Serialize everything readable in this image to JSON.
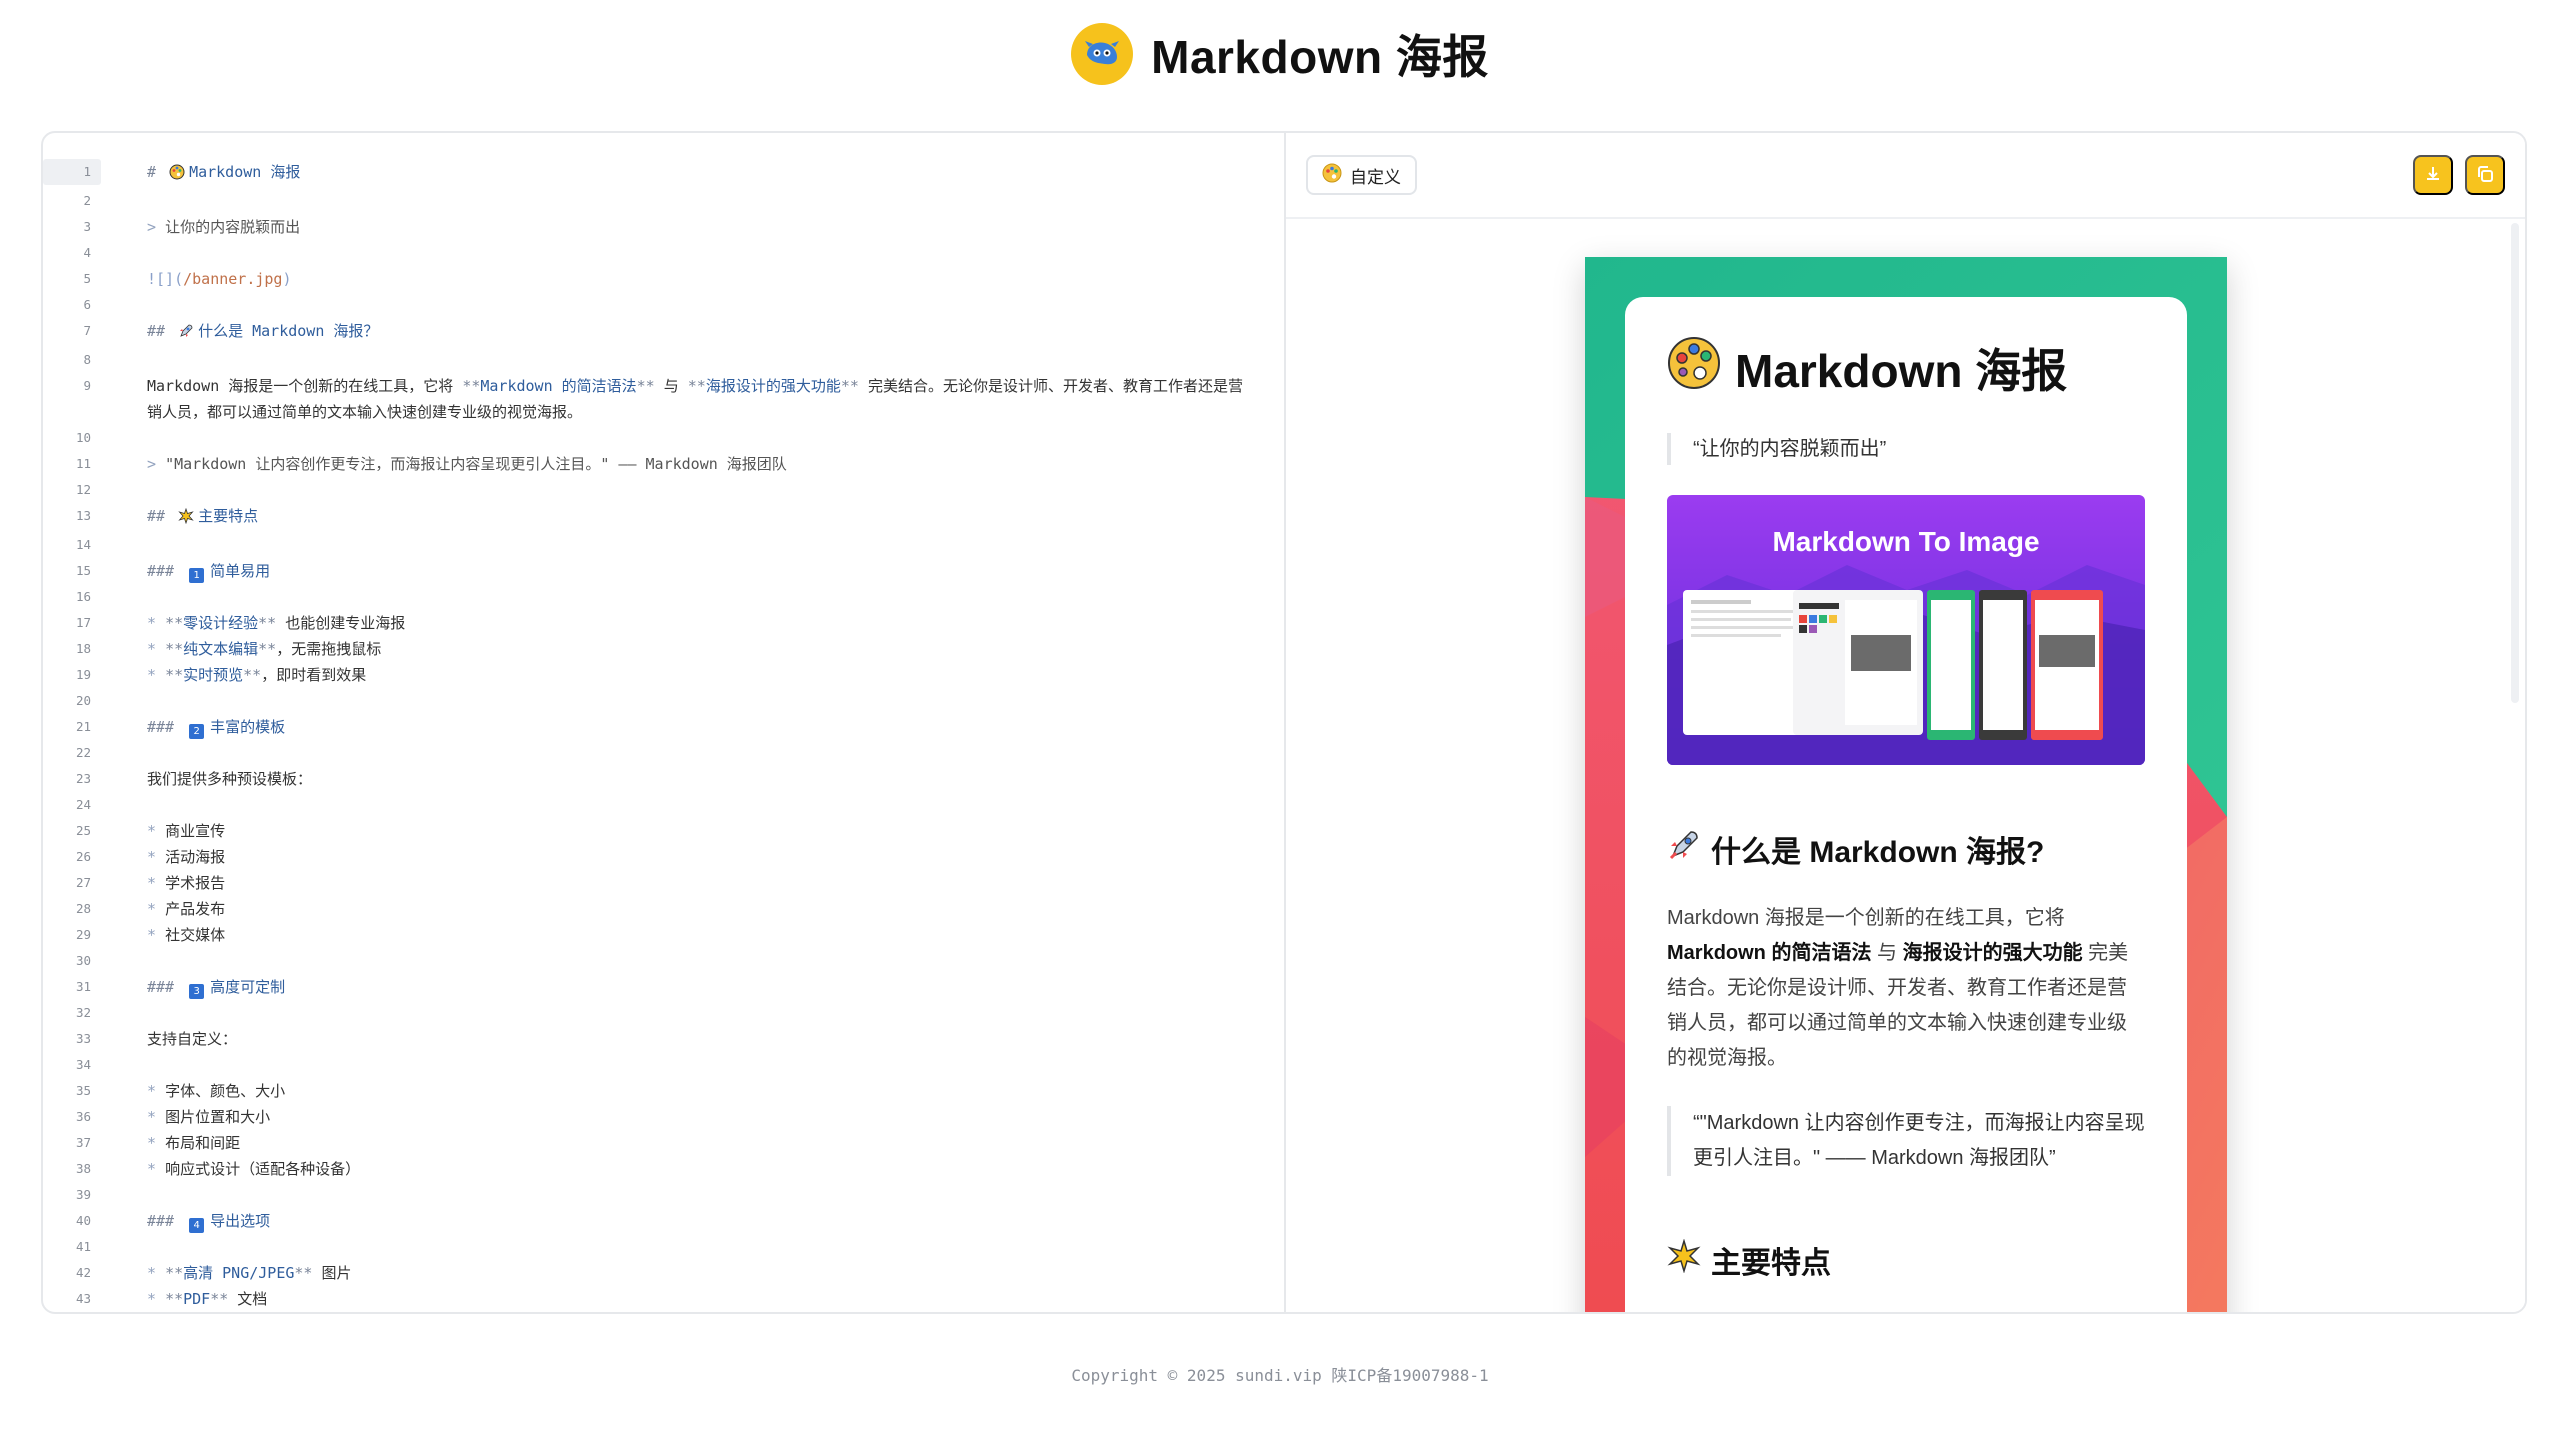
{
  "header": {
    "title": "Markdown 海报"
  },
  "editor": {
    "lines": [
      {
        "n": "1",
        "fold": true,
        "active": true,
        "parts": [
          {
            "c": "mk",
            "t": "# "
          },
          {
            "e": "palette"
          },
          {
            "c": "hd",
            "t": "Markdown 海报"
          }
        ]
      },
      {
        "n": "2",
        "parts": []
      },
      {
        "n": "3",
        "parts": [
          {
            "c": "bullet",
            "t": "> "
          },
          {
            "c": "quote",
            "t": "让你的内容脱颖而出"
          }
        ]
      },
      {
        "n": "4",
        "parts": []
      },
      {
        "n": "5",
        "parts": [
          {
            "c": "img-br",
            "t": "![]("
          },
          {
            "c": "img-link",
            "t": "/banner.jpg"
          },
          {
            "c": "img-br",
            "t": ")"
          }
        ]
      },
      {
        "n": "6",
        "parts": []
      },
      {
        "n": "7",
        "fold": true,
        "parts": [
          {
            "c": "mk",
            "t": "## "
          },
          {
            "e": "rocket"
          },
          {
            "c": "hd",
            "t": "什么是 Markdown 海报？"
          }
        ]
      },
      {
        "n": "8",
        "parts": []
      },
      {
        "n": "9",
        "parts": [
          {
            "t": "Markdown 海报是一个创新的在线工具，它将 "
          },
          {
            "c": "mk",
            "t": "**"
          },
          {
            "c": "bd",
            "t": "Markdown 的简洁语法"
          },
          {
            "c": "mk",
            "t": "**"
          },
          {
            "t": " 与 "
          },
          {
            "c": "mk",
            "t": "**"
          },
          {
            "c": "bd",
            "t": "海报设计的强大功能"
          },
          {
            "c": "mk",
            "t": "**"
          },
          {
            "t": " 完美结合。无论你是设计师、开发者、教育工作者还是营销人员，都可以通过简单的文本输入快速创建专业级的视觉海报。"
          }
        ]
      },
      {
        "n": "10",
        "parts": []
      },
      {
        "n": "11",
        "parts": [
          {
            "c": "bullet",
            "t": "> "
          },
          {
            "c": "quote",
            "t": "\"Markdown 让内容创作更专注，而海报让内容呈现更引人注目。\" —— Markdown 海报团队"
          }
        ]
      },
      {
        "n": "12",
        "parts": []
      },
      {
        "n": "13",
        "fold": true,
        "parts": [
          {
            "c": "mk",
            "t": "## "
          },
          {
            "e": "sparkle"
          },
          {
            "c": "hd",
            "t": "主要特点"
          }
        ]
      },
      {
        "n": "14",
        "parts": []
      },
      {
        "n": "15",
        "fold": true,
        "parts": [
          {
            "c": "mk",
            "t": "### "
          },
          {
            "num": "1"
          },
          {
            "c": "hd",
            "t": "简单易用"
          }
        ]
      },
      {
        "n": "16",
        "parts": []
      },
      {
        "n": "17",
        "parts": [
          {
            "c": "bullet",
            "t": "* "
          },
          {
            "c": "mk",
            "t": "**"
          },
          {
            "c": "bd",
            "t": "零设计经验"
          },
          {
            "c": "mk",
            "t": "**"
          },
          {
            "t": " 也能创建专业海报"
          }
        ]
      },
      {
        "n": "18",
        "parts": [
          {
            "c": "bullet",
            "t": "* "
          },
          {
            "c": "mk",
            "t": "**"
          },
          {
            "c": "bd",
            "t": "纯文本编辑"
          },
          {
            "c": "mk",
            "t": "**"
          },
          {
            "t": "，无需拖拽鼠标"
          }
        ]
      },
      {
        "n": "19",
        "parts": [
          {
            "c": "bullet",
            "t": "* "
          },
          {
            "c": "mk",
            "t": "**"
          },
          {
            "c": "bd",
            "t": "实时预览"
          },
          {
            "c": "mk",
            "t": "**"
          },
          {
            "t": "，即时看到效果"
          }
        ]
      },
      {
        "n": "20",
        "parts": []
      },
      {
        "n": "21",
        "fold": true,
        "parts": [
          {
            "c": "mk",
            "t": "### "
          },
          {
            "num": "2"
          },
          {
            "c": "hd",
            "t": "丰富的模板"
          }
        ]
      },
      {
        "n": "22",
        "parts": []
      },
      {
        "n": "23",
        "parts": [
          {
            "t": "我们提供多种预设模板："
          }
        ]
      },
      {
        "n": "24",
        "parts": []
      },
      {
        "n": "25",
        "parts": [
          {
            "c": "bullet",
            "t": "* "
          },
          {
            "t": "商业宣传"
          }
        ]
      },
      {
        "n": "26",
        "parts": [
          {
            "c": "bullet",
            "t": "* "
          },
          {
            "t": "活动海报"
          }
        ]
      },
      {
        "n": "27",
        "parts": [
          {
            "c": "bullet",
            "t": "* "
          },
          {
            "t": "学术报告"
          }
        ]
      },
      {
        "n": "28",
        "parts": [
          {
            "c": "bullet",
            "t": "* "
          },
          {
            "t": "产品发布"
          }
        ]
      },
      {
        "n": "29",
        "parts": [
          {
            "c": "bullet",
            "t": "* "
          },
          {
            "t": "社交媒体"
          }
        ]
      },
      {
        "n": "30",
        "parts": []
      },
      {
        "n": "31",
        "fold": true,
        "parts": [
          {
            "c": "mk",
            "t": "### "
          },
          {
            "num": "3"
          },
          {
            "c": "hd",
            "t": "高度可定制"
          }
        ]
      },
      {
        "n": "32",
        "parts": []
      },
      {
        "n": "33",
        "parts": [
          {
            "t": "支持自定义："
          }
        ]
      },
      {
        "n": "34",
        "parts": []
      },
      {
        "n": "35",
        "parts": [
          {
            "c": "bullet",
            "t": "* "
          },
          {
            "t": "字体、颜色、大小"
          }
        ]
      },
      {
        "n": "36",
        "parts": [
          {
            "c": "bullet",
            "t": "* "
          },
          {
            "t": "图片位置和大小"
          }
        ]
      },
      {
        "n": "37",
        "parts": [
          {
            "c": "bullet",
            "t": "* "
          },
          {
            "t": "布局和间距"
          }
        ]
      },
      {
        "n": "38",
        "parts": [
          {
            "c": "bullet",
            "t": "* "
          },
          {
            "t": "响应式设计（适配各种设备）"
          }
        ]
      },
      {
        "n": "39",
        "parts": []
      },
      {
        "n": "40",
        "fold": true,
        "parts": [
          {
            "c": "mk",
            "t": "### "
          },
          {
            "num": "4"
          },
          {
            "c": "hd",
            "t": "导出选项"
          }
        ]
      },
      {
        "n": "41",
        "parts": []
      },
      {
        "n": "42",
        "parts": [
          {
            "c": "bullet",
            "t": "* "
          },
          {
            "c": "mk",
            "t": "**"
          },
          {
            "c": "bd",
            "t": "高清 PNG/JPEG"
          },
          {
            "c": "mk",
            "t": "**"
          },
          {
            "t": " 图片"
          }
        ]
      },
      {
        "n": "43",
        "parts": [
          {
            "c": "bullet",
            "t": "* "
          },
          {
            "c": "mk",
            "t": "**"
          },
          {
            "c": "bd",
            "t": "PDF"
          },
          {
            "c": "mk",
            "t": "**"
          },
          {
            "t": " 文档"
          }
        ]
      }
    ]
  },
  "preview": {
    "customize_label": "自定义",
    "download_icon": "download-icon",
    "copy_icon": "copy-icon",
    "colors": {
      "accent": "#f7c31e",
      "poster_green": "#1fb88a",
      "poster_red": "#f0485e"
    },
    "poster": {
      "title": "Markdown 海报",
      "quote1": "“让你的内容脱颖而出”",
      "banner_title": "Markdown To Image",
      "h2": "什么是 Markdown 海报?",
      "para_1": "Markdown 海报是一个创新的在线工具，它将 ",
      "para_bold_1": "Markdown 的简洁语法",
      "para_2": " 与 ",
      "para_bold_2": "海报设计的强大功能",
      "para_3": " 完美结合。无论你是设计师、开发者、教育工作者还是营销人员，都可以通过简单的文本输入快速创建专业级的视觉海报。",
      "quote2": "“\"Markdown 让内容创作更专注，而海报让内容呈现更引人注目。\" —— Markdown 海报团队”",
      "h2b": "主要特点"
    }
  },
  "footer": {
    "text": "Copyright © 2025 sundi.vip 陕ICP备19007988-1"
  }
}
